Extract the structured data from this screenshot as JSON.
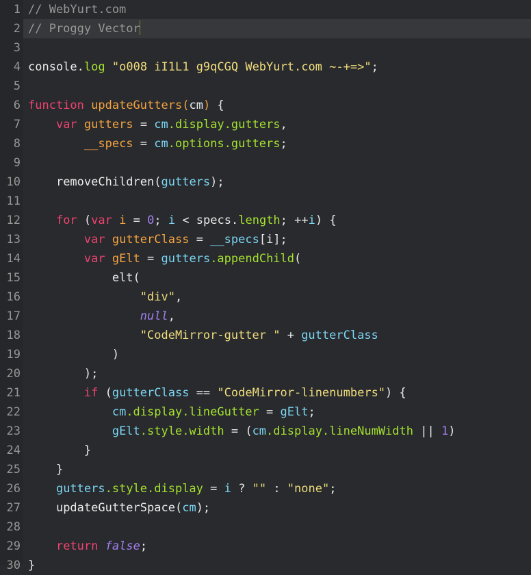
{
  "editor": {
    "theme_name": "dark",
    "font_label": "Proggy Vector",
    "colors": {
      "background": "#282a2e",
      "gutter_background": "#25272a",
      "active_line": "#36383b",
      "line_number": "#969896",
      "foreground": "#eaeaea",
      "comment": "#969896",
      "keyword": "#f0436f",
      "definition": "#f5a340",
      "variable2": "#7cd5f1",
      "property": "#a6e22e",
      "string": "#f0dc7c",
      "number": "#a37ff0",
      "atom": "#a37ff0",
      "cursor": "#8c8340"
    },
    "active_line_number": 2,
    "cursor": {
      "line": 2,
      "column": 17
    },
    "total_lines": 30
  },
  "code_lines": [
    {
      "n": "1",
      "tokens": [
        {
          "t": "// WebYurt.com",
          "c": "t-comment"
        }
      ]
    },
    {
      "n": "2",
      "active": true,
      "tokens": [
        {
          "t": "// Proggy Vector",
          "c": "t-comment"
        },
        {
          "t": "",
          "c": "cursor"
        }
      ]
    },
    {
      "n": "3",
      "tokens": []
    },
    {
      "n": "4",
      "tokens": [
        {
          "t": "console",
          "c": "t-plain"
        },
        {
          "t": ".",
          "c": "t-plain"
        },
        {
          "t": "log",
          "c": "t-prop"
        },
        {
          "t": " ",
          "c": "t-plain"
        },
        {
          "t": "\"o008 iI1L1 g9qCGQ WebYurt.com ~-+=>\"",
          "c": "t-string"
        },
        {
          "t": ";",
          "c": "t-plain"
        }
      ]
    },
    {
      "n": "5",
      "tokens": []
    },
    {
      "n": "6",
      "tokens": [
        {
          "t": "function",
          "c": "t-keyword"
        },
        {
          "t": " ",
          "c": "t-plain"
        },
        {
          "t": "updateGutters",
          "c": "t-def"
        },
        {
          "t": "(",
          "c": "t-def"
        },
        {
          "t": "cm",
          "c": "t-plain"
        },
        {
          "t": ")",
          "c": "t-def"
        },
        {
          "t": " {",
          "c": "t-plain"
        }
      ]
    },
    {
      "n": "7",
      "tokens": [
        {
          "t": "    ",
          "c": "t-plain"
        },
        {
          "t": "var",
          "c": "t-keyword"
        },
        {
          "t": " ",
          "c": "t-plain"
        },
        {
          "t": "gutters",
          "c": "t-def"
        },
        {
          "t": " = ",
          "c": "t-plain"
        },
        {
          "t": "cm",
          "c": "t-var2"
        },
        {
          "t": ".display.gutters",
          "c": "t-prop"
        },
        {
          "t": ",",
          "c": "t-plain"
        }
      ]
    },
    {
      "n": "8",
      "tokens": [
        {
          "t": "        ",
          "c": "t-plain"
        },
        {
          "t": "__specs",
          "c": "t-def"
        },
        {
          "t": " = ",
          "c": "t-plain"
        },
        {
          "t": "cm",
          "c": "t-var2"
        },
        {
          "t": ".options.gutters",
          "c": "t-prop"
        },
        {
          "t": ";",
          "c": "t-plain"
        }
      ]
    },
    {
      "n": "9",
      "tokens": []
    },
    {
      "n": "10",
      "tokens": [
        {
          "t": "    ",
          "c": "t-plain"
        },
        {
          "t": "removeChildren",
          "c": "t-plain"
        },
        {
          "t": "(",
          "c": "t-plain"
        },
        {
          "t": "gutters",
          "c": "t-var2"
        },
        {
          "t": ");",
          "c": "t-plain"
        }
      ]
    },
    {
      "n": "11",
      "tokens": []
    },
    {
      "n": "12",
      "tokens": [
        {
          "t": "    ",
          "c": "t-plain"
        },
        {
          "t": "for",
          "c": "t-keyword"
        },
        {
          "t": " (",
          "c": "t-plain"
        },
        {
          "t": "var",
          "c": "t-keyword"
        },
        {
          "t": " ",
          "c": "t-plain"
        },
        {
          "t": "i",
          "c": "t-def"
        },
        {
          "t": " = ",
          "c": "t-plain"
        },
        {
          "t": "0",
          "c": "t-number"
        },
        {
          "t": "; ",
          "c": "t-plain"
        },
        {
          "t": "i",
          "c": "t-var2"
        },
        {
          "t": " < ",
          "c": "t-plain"
        },
        {
          "t": "specs",
          "c": "t-plain"
        },
        {
          "t": ".",
          "c": "t-plain"
        },
        {
          "t": "length",
          "c": "t-prop"
        },
        {
          "t": "; ++",
          "c": "t-plain"
        },
        {
          "t": "i",
          "c": "t-var2"
        },
        {
          "t": ") {",
          "c": "t-plain"
        }
      ]
    },
    {
      "n": "13",
      "tokens": [
        {
          "t": "        ",
          "c": "t-plain"
        },
        {
          "t": "var",
          "c": "t-keyword"
        },
        {
          "t": " ",
          "c": "t-plain"
        },
        {
          "t": "gutterClass",
          "c": "t-def"
        },
        {
          "t": " = ",
          "c": "t-plain"
        },
        {
          "t": "__specs",
          "c": "t-var2"
        },
        {
          "t": "[i];",
          "c": "t-plain"
        }
      ]
    },
    {
      "n": "14",
      "tokens": [
        {
          "t": "        ",
          "c": "t-plain"
        },
        {
          "t": "var",
          "c": "t-keyword"
        },
        {
          "t": " ",
          "c": "t-plain"
        },
        {
          "t": "gElt",
          "c": "t-def"
        },
        {
          "t": " = ",
          "c": "t-plain"
        },
        {
          "t": "gutters",
          "c": "t-var2"
        },
        {
          "t": ".appendChild",
          "c": "t-prop"
        },
        {
          "t": "(",
          "c": "t-plain"
        }
      ]
    },
    {
      "n": "15",
      "tokens": [
        {
          "t": "            ",
          "c": "t-plain"
        },
        {
          "t": "elt(",
          "c": "t-plain"
        }
      ]
    },
    {
      "n": "16",
      "tokens": [
        {
          "t": "                ",
          "c": "t-plain"
        },
        {
          "t": "\"div\"",
          "c": "t-string"
        },
        {
          "t": ",",
          "c": "t-plain"
        }
      ]
    },
    {
      "n": "17",
      "tokens": [
        {
          "t": "                ",
          "c": "t-plain"
        },
        {
          "t": "null",
          "c": "t-atom"
        },
        {
          "t": ",",
          "c": "t-plain"
        }
      ]
    },
    {
      "n": "18",
      "tokens": [
        {
          "t": "                ",
          "c": "t-plain"
        },
        {
          "t": "\"CodeMirror-gutter \"",
          "c": "t-string"
        },
        {
          "t": " + ",
          "c": "t-plain"
        },
        {
          "t": "gutterClass",
          "c": "t-var2"
        }
      ]
    },
    {
      "n": "19",
      "tokens": [
        {
          "t": "            ",
          "c": "t-plain"
        },
        {
          "t": ")",
          "c": "t-plain"
        }
      ]
    },
    {
      "n": "20",
      "tokens": [
        {
          "t": "        ",
          "c": "t-plain"
        },
        {
          "t": ");",
          "c": "t-plain"
        }
      ]
    },
    {
      "n": "21",
      "tokens": [
        {
          "t": "        ",
          "c": "t-plain"
        },
        {
          "t": "if",
          "c": "t-keyword"
        },
        {
          "t": " (",
          "c": "t-plain"
        },
        {
          "t": "gutterClass",
          "c": "t-var2"
        },
        {
          "t": " == ",
          "c": "t-plain"
        },
        {
          "t": "\"CodeMirror-linenumbers\"",
          "c": "t-string"
        },
        {
          "t": ") {",
          "c": "t-plain"
        }
      ]
    },
    {
      "n": "22",
      "tokens": [
        {
          "t": "            ",
          "c": "t-plain"
        },
        {
          "t": "cm",
          "c": "t-var2"
        },
        {
          "t": ".display.lineGutter",
          "c": "t-prop"
        },
        {
          "t": " = ",
          "c": "t-plain"
        },
        {
          "t": "gElt",
          "c": "t-var2"
        },
        {
          "t": ";",
          "c": "t-plain"
        }
      ]
    },
    {
      "n": "23",
      "tokens": [
        {
          "t": "            ",
          "c": "t-plain"
        },
        {
          "t": "gElt",
          "c": "t-var2"
        },
        {
          "t": ".style.width",
          "c": "t-prop"
        },
        {
          "t": " = (",
          "c": "t-plain"
        },
        {
          "t": "cm",
          "c": "t-var2"
        },
        {
          "t": ".display.lineNumWidth",
          "c": "t-prop"
        },
        {
          "t": " || ",
          "c": "t-plain"
        },
        {
          "t": "1",
          "c": "t-number"
        },
        {
          "t": ")",
          "c": "t-plain"
        }
      ]
    },
    {
      "n": "24",
      "tokens": [
        {
          "t": "        ",
          "c": "t-plain"
        },
        {
          "t": "}",
          "c": "t-plain"
        }
      ]
    },
    {
      "n": "25",
      "tokens": [
        {
          "t": "    ",
          "c": "t-plain"
        },
        {
          "t": "}",
          "c": "t-plain"
        }
      ]
    },
    {
      "n": "26",
      "tokens": [
        {
          "t": "    ",
          "c": "t-plain"
        },
        {
          "t": "gutters",
          "c": "t-var2"
        },
        {
          "t": ".style.display",
          "c": "t-prop"
        },
        {
          "t": " = ",
          "c": "t-plain"
        },
        {
          "t": "i",
          "c": "t-var2"
        },
        {
          "t": " ? ",
          "c": "t-plain"
        },
        {
          "t": "\"\"",
          "c": "t-string"
        },
        {
          "t": " : ",
          "c": "t-plain"
        },
        {
          "t": "\"none\"",
          "c": "t-string"
        },
        {
          "t": ";",
          "c": "t-plain"
        }
      ]
    },
    {
      "n": "27",
      "tokens": [
        {
          "t": "    ",
          "c": "t-plain"
        },
        {
          "t": "updateGutterSpace",
          "c": "t-plain"
        },
        {
          "t": "(",
          "c": "t-plain"
        },
        {
          "t": "cm",
          "c": "t-var2"
        },
        {
          "t": ");",
          "c": "t-plain"
        }
      ]
    },
    {
      "n": "28",
      "tokens": []
    },
    {
      "n": "29",
      "tokens": [
        {
          "t": "    ",
          "c": "t-plain"
        },
        {
          "t": "return",
          "c": "t-keyword"
        },
        {
          "t": " ",
          "c": "t-plain"
        },
        {
          "t": "false",
          "c": "t-atom"
        },
        {
          "t": ";",
          "c": "t-plain"
        }
      ]
    },
    {
      "n": "30",
      "tokens": [
        {
          "t": "}",
          "c": "t-plain"
        }
      ]
    }
  ]
}
